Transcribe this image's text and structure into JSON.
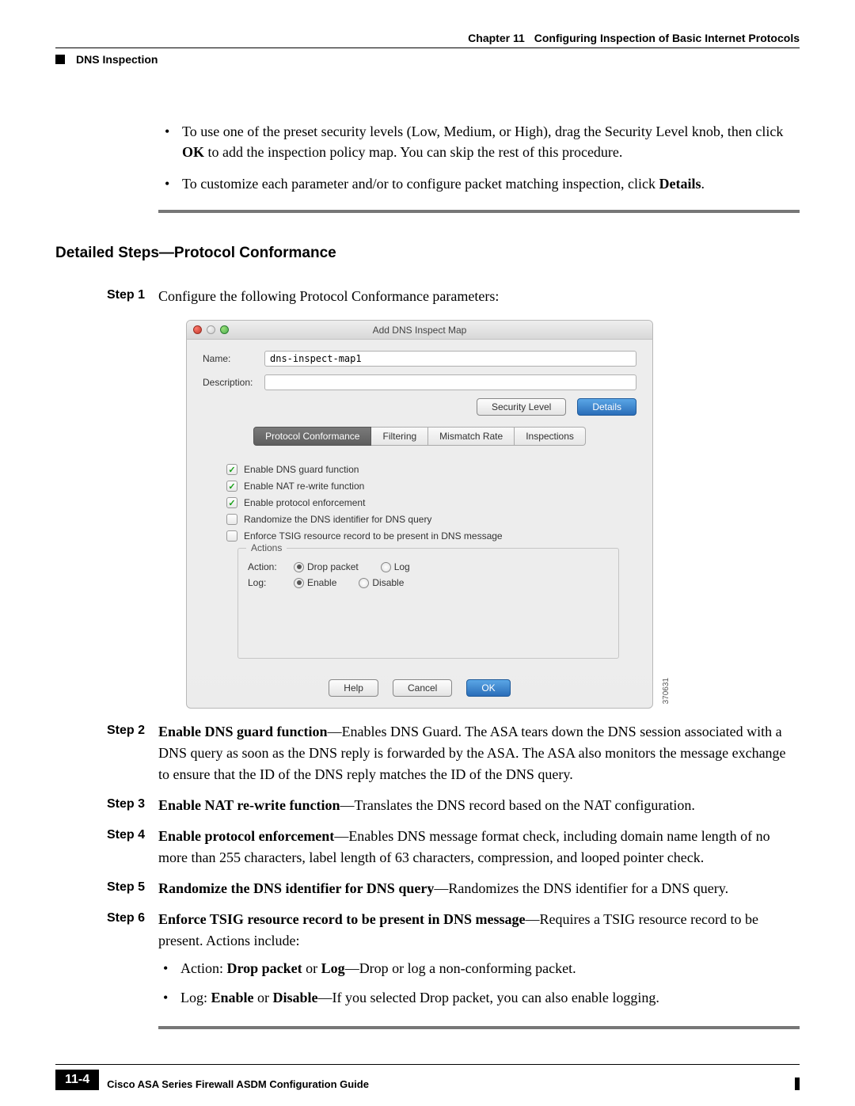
{
  "header": {
    "chapter_label": "Chapter 11",
    "chapter_title": "Configuring Inspection of Basic Internet Protocols",
    "section": "DNS Inspection"
  },
  "intro_bullets": [
    {
      "pre": "To use one of the preset security levels (Low, Medium, or High), drag the Security Level knob, then click ",
      "bold1": "OK",
      "post": " to add the inspection policy map. You can skip the rest of this procedure."
    },
    {
      "pre": "To customize each parameter and/or to configure packet matching inspection, click ",
      "bold1": "Details",
      "post": "."
    }
  ],
  "section_heading": "Detailed Steps—Protocol Conformance",
  "steps": {
    "s1": {
      "label": "Step 1",
      "text": "Configure the following Protocol Conformance parameters:"
    },
    "s2": {
      "label": "Step 2",
      "bold": "Enable DNS guard function",
      "text": "—Enables DNS Guard. The ASA tears down the DNS session associated with a DNS query as soon as the DNS reply is forwarded by the ASA. The ASA also monitors the message exchange to ensure that the ID of the DNS reply matches the ID of the DNS query."
    },
    "s3": {
      "label": "Step 3",
      "bold": "Enable NAT re-write function",
      "text": "—Translates the DNS record based on the NAT configuration."
    },
    "s4": {
      "label": "Step 4",
      "bold": "Enable protocol enforcement",
      "text": "—Enables DNS message format check, including domain name length of no more than 255 characters, label length of 63 characters, compression, and looped pointer check."
    },
    "s5": {
      "label": "Step 5",
      "bold": "Randomize the DNS identifier for DNS query",
      "text": "—Randomizes the DNS identifier for a DNS query."
    },
    "s6": {
      "label": "Step 6",
      "bold": "Enforce TSIG resource record to be present in DNS message",
      "text": "—Requires a TSIG resource record to be present. Actions include:",
      "sub": [
        {
          "pre": "Action: ",
          "b1": "Drop packet",
          "mid": " or ",
          "b2": "Log",
          "post": "—Drop or log a non-conforming packet."
        },
        {
          "pre": "Log: ",
          "b1": "Enable",
          "mid": " or ",
          "b2": "Disable",
          "post": "—If you selected Drop packet, you can also enable logging."
        }
      ]
    }
  },
  "dialog": {
    "title": "Add DNS Inspect Map",
    "name_label": "Name:",
    "name_value": "dns-inspect-map1",
    "desc_label": "Description:",
    "desc_value": "",
    "btn_security": "Security Level",
    "btn_details": "Details",
    "tabs": [
      "Protocol Conformance",
      "Filtering",
      "Mismatch Rate",
      "Inspections"
    ],
    "checks": [
      {
        "label": "Enable DNS guard function",
        "checked": true
      },
      {
        "label": "Enable NAT re-write function",
        "checked": true
      },
      {
        "label": "Enable protocol enforcement",
        "checked": true
      },
      {
        "label": "Randomize the DNS identifier for DNS query",
        "checked": false
      },
      {
        "label": "Enforce TSIG resource record to be present in DNS message",
        "checked": false
      }
    ],
    "fieldset_legend": "Actions",
    "action_label": "Action:",
    "action_opts": [
      "Drop packet",
      "Log"
    ],
    "log_label": "Log:",
    "log_opts": [
      "Enable",
      "Disable"
    ],
    "btn_help": "Help",
    "btn_cancel": "Cancel",
    "btn_ok": "OK",
    "image_id": "370631"
  },
  "footer": {
    "guide": "Cisco ASA Series Firewall ASDM Configuration Guide",
    "page": "11-4"
  }
}
